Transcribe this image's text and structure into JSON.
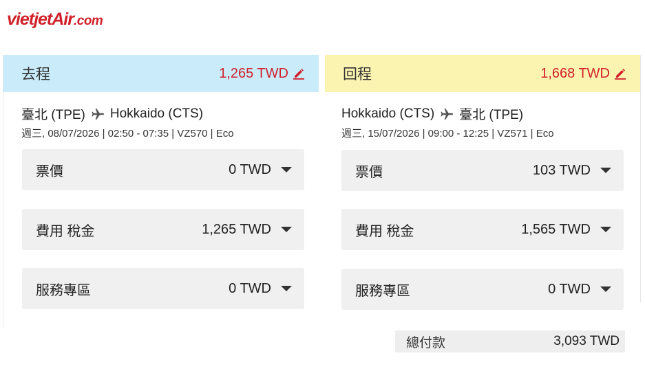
{
  "brand": {
    "logo_main": "vietjetAir",
    "logo_suffix": ".com",
    "color": "#d0212b"
  },
  "outbound": {
    "label": "去程",
    "price": "1,265 TWD",
    "origin": "臺北 (TPE)",
    "destination": "Hokkaido (CTS)",
    "details": "週三, 08/07/2026 | 02:50 - 07:35 | VZ570 | Eco",
    "header_color": "#c9ebfa",
    "fees": [
      {
        "label": "票價",
        "amount": "0 TWD"
      },
      {
        "label": "費用 稅金",
        "amount": "1,265 TWD"
      },
      {
        "label": "服務專區",
        "amount": "0 TWD"
      }
    ]
  },
  "return": {
    "label": "回程",
    "price": "1,668 TWD",
    "origin": "Hokkaido (CTS)",
    "destination": "臺北 (TPE)",
    "details": "週三, 15/07/2026 | 09:00 - 12:25 | VZ571 | Eco",
    "header_color": "#fbf3b0",
    "fees": [
      {
        "label": "票價",
        "amount": "103 TWD"
      },
      {
        "label": "費用 稅金",
        "amount": "1,565 TWD"
      },
      {
        "label": "服務專區",
        "amount": "0 TWD"
      }
    ]
  },
  "total": {
    "label": "總付款",
    "amount": "3,093 TWD"
  },
  "icons": {
    "edit": "pencil-icon",
    "route": "airplane-icon",
    "expand": "caret-down-icon"
  }
}
